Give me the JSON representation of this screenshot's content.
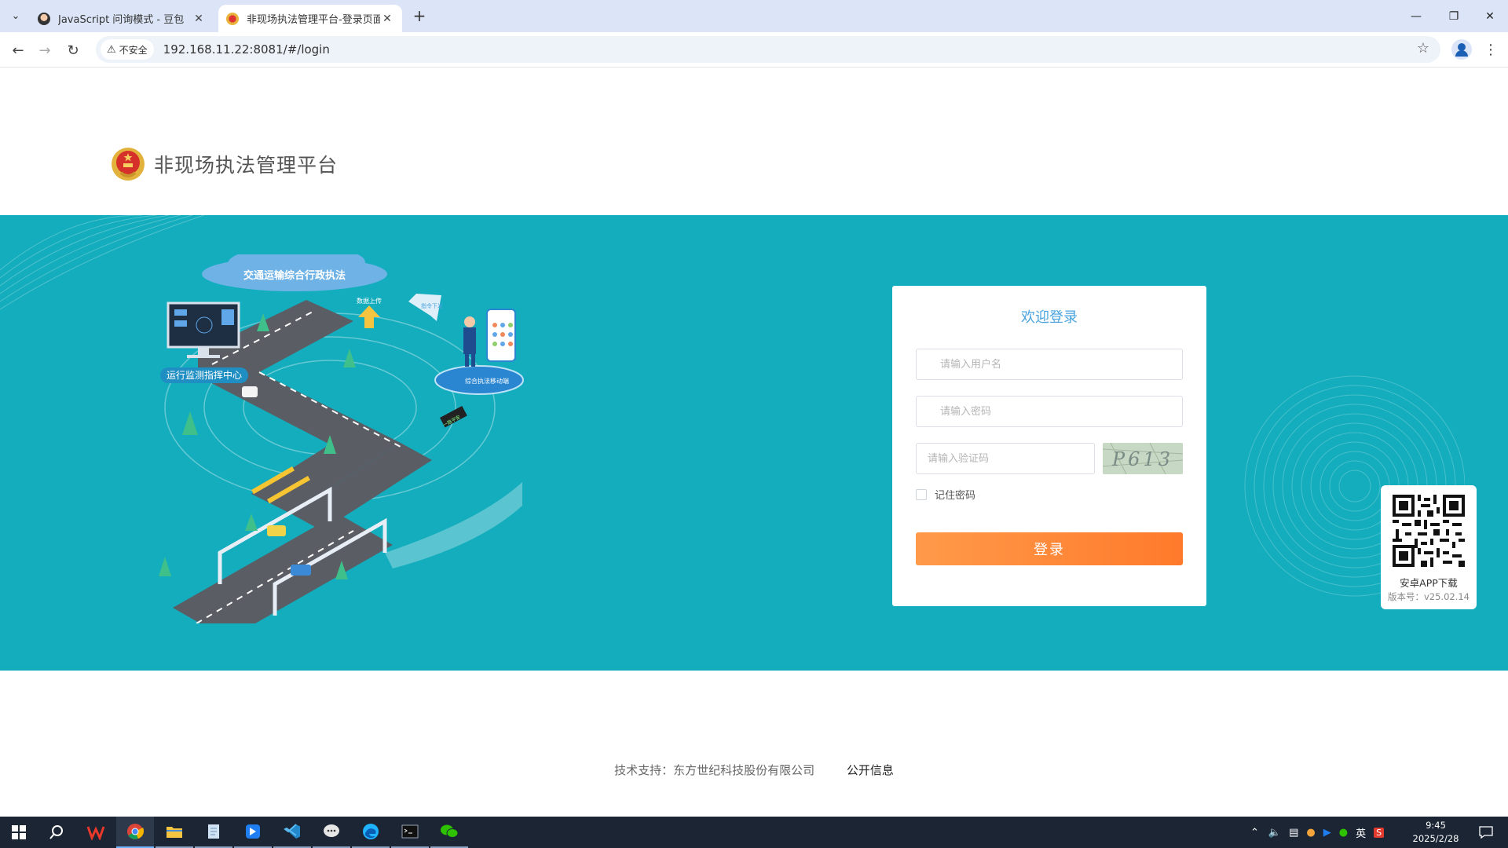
{
  "browser": {
    "tabs": [
      {
        "title": "JavaScript 问询模式 - 豆包",
        "active": false
      },
      {
        "title": "非现场执法管理平台-登录页面",
        "active": true
      }
    ],
    "security_label": "不安全",
    "url": "192.168.11.22:8081/#/login",
    "icons": [
      "tab-search-icon",
      "back-icon",
      "forward-icon",
      "reload-icon",
      "warning-icon",
      "bookmark-star-icon",
      "profile-icon",
      "menu-kebab-icon",
      "minimize-icon",
      "restore-icon",
      "close-icon",
      "new-tab-icon"
    ]
  },
  "header": {
    "platform_title": "非现场执法管理平台"
  },
  "banner": {
    "colors": {
      "background": "#14adbd"
    },
    "illustration": {
      "cloud_label": "交通运输综合行政执法",
      "monitor_label": "运行监测指挥中心",
      "mobile_label": "综合执法移动端",
      "upload_label": "数据上传",
      "dispatch_label": "指令下发",
      "sign_label": "一路平安"
    }
  },
  "login": {
    "welcome": "欢迎登录",
    "username_placeholder": "请输入用户名",
    "password_placeholder": "请输入密码",
    "captcha_placeholder": "请输入验证码",
    "captcha_text": "P613",
    "remember_label": "记住密码",
    "remember_checked": false,
    "submit_label": "登录",
    "colors": {
      "title": "#4aa3df",
      "button": "#ff7a2b"
    }
  },
  "app_download": {
    "label": "安卓APP下载",
    "version": "版本号：v25.02.14"
  },
  "footer": {
    "support_text": "技术支持：东方世纪科技股份有限公司",
    "public_info_link": "公开信息"
  },
  "taskbar": {
    "apps": [
      "start-icon",
      "search-icon",
      "wps-icon",
      "chrome-icon",
      "file-explorer-icon",
      "notepad-icon",
      "feishu-icon",
      "vscode-icon",
      "chat-icon",
      "edge-icon",
      "terminal-icon",
      "wechat-icon"
    ],
    "tray": {
      "ime": "英",
      "time": "9:45",
      "date": "2025/2/28"
    }
  }
}
